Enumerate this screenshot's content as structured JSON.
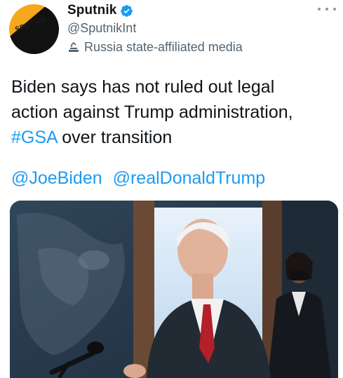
{
  "author": {
    "display_name": "Sputnik",
    "handle": "@SputnikInt",
    "avatar_text": "SPUTNIK",
    "affiliation_label": "Russia state-affiliated media"
  },
  "tweet": {
    "text_line1": "Biden says has not ruled out legal",
    "text_line2": "action against Trump administration,",
    "hashtag": "#GSA",
    "text_line3_rest": " over transition",
    "mentions": [
      "@JoeBiden",
      "@realDonaldTrump"
    ]
  },
  "colors": {
    "link": "#1d9bf0",
    "secondary_text": "#536471",
    "verified_badge": "#1d9bf0",
    "avatar_orange": "#f5a81c"
  },
  "icons": {
    "verified": "verified-badge-icon",
    "label": "state-media-label-icon",
    "more": "more-options-icon"
  }
}
